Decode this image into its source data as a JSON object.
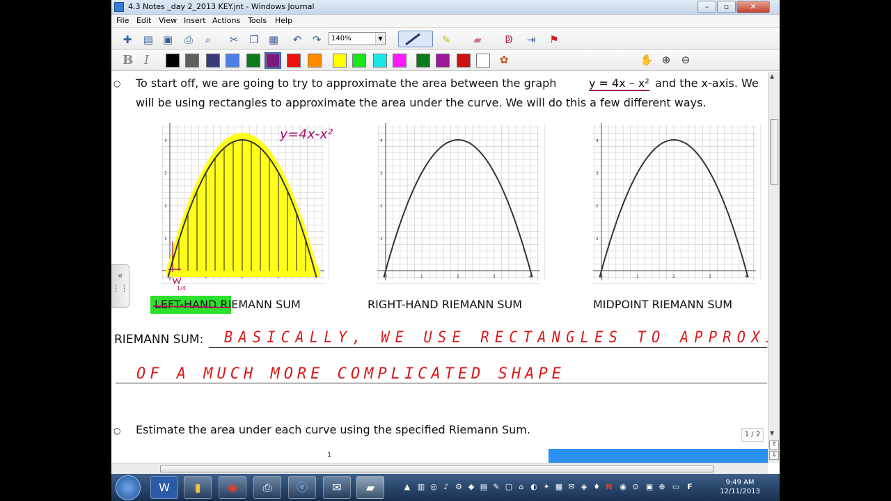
{
  "window": {
    "title": "4.3 Notes _day 2_2013 KEY.jnt - Windows Journal"
  },
  "menu": [
    "File",
    "Edit",
    "View",
    "Insert",
    "Actions",
    "Tools",
    "Help"
  ],
  "toolbar": {
    "zoom": "140%"
  },
  "toolbar2": {
    "bold": "B",
    "italic": "I"
  },
  "colors": [
    "#000000",
    "#5f5f5f",
    "#3a3a7a",
    "#4f7fe6",
    "#0d7a1a",
    "#7a1a7a",
    "#ee1111",
    "#ff8a00",
    "#ffff00",
    "#19e619",
    "#19e6e6",
    "#ff19ff",
    "#0d7a1a",
    "#9a1a9a",
    "#cc1111",
    "#ffffff"
  ],
  "content": {
    "intro_line1": "To start off, we are going to try to approximate the area between the graph",
    "equation": "y = 4x – x²",
    "intro_tail": "and the x-axis.  We",
    "intro_line2": "will be using rectangles to approximate the area under the curve.  We will do this a few different ways.",
    "handwritten_equation": "y=4x-x²",
    "graph_labels": [
      "LEFT-HAND RIEMANN SUM",
      "RIGHT-HAND RIEMANN SUM",
      "MIDPOINT RIEMANN SUM"
    ],
    "riemann_label": "RIEMANN SUM:",
    "definition_line1": "BASICALLY, WE USE RECTANGLES TO APPROXIMATE THE AREA",
    "definition_line2": "OF A MUCH MORE COMPLICATED SHAPE",
    "estimate_line": "Estimate the area under each curve using the specified Riemann Sum.",
    "ruler_page": "1",
    "handwritten_quarter": "1/4",
    "y_ticks": [
      "4",
      "3",
      "2",
      "1"
    ],
    "x_ticks": [
      "0",
      "1",
      "2",
      "3",
      "4"
    ]
  },
  "page_indicator": "1 / 2",
  "taskbar": {
    "time": "9:49 AM",
    "date": "12/11/2013"
  }
}
